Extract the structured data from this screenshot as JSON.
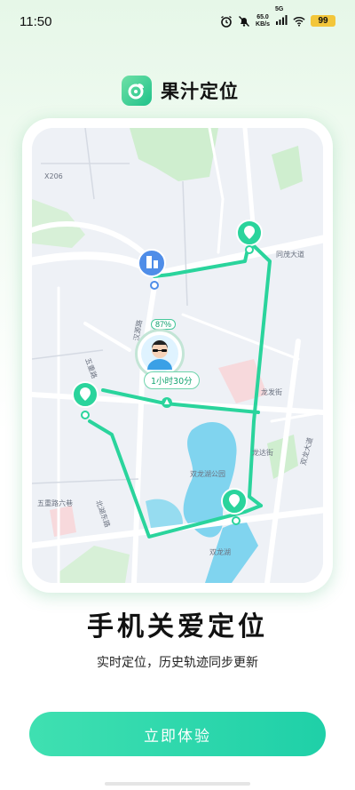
{
  "status_bar": {
    "time": "11:50",
    "net_speed_value": "65.0",
    "net_speed_unit": "KB/s",
    "network_type": "5G",
    "battery_level": "99"
  },
  "brand": {
    "app_name": "果汁定位",
    "accent_color": "#1fc28a"
  },
  "map": {
    "labels": {
      "x206": "X206",
      "tongmao_road": "同茂大道",
      "longfa_street": "龙发街",
      "longda_street": "龙达街",
      "shuanglong_park": "双龙湖公园",
      "shuanglong_lake": "双龙湖",
      "wuzhong_road": "五重路",
      "wuzhong_road_6": "五重路六巷",
      "beihu_east": "北湖东路",
      "shuanglong_avenue": "双龙大道",
      "hanzhong_road": "汉源路"
    },
    "battery_percent": "87%",
    "duration": "1小时30分",
    "route_color": "#2ad49c"
  },
  "headline": "手机关爱定位",
  "subtitle": "实时定位，历史轨迹同步更新",
  "cta_label": "立即体验"
}
